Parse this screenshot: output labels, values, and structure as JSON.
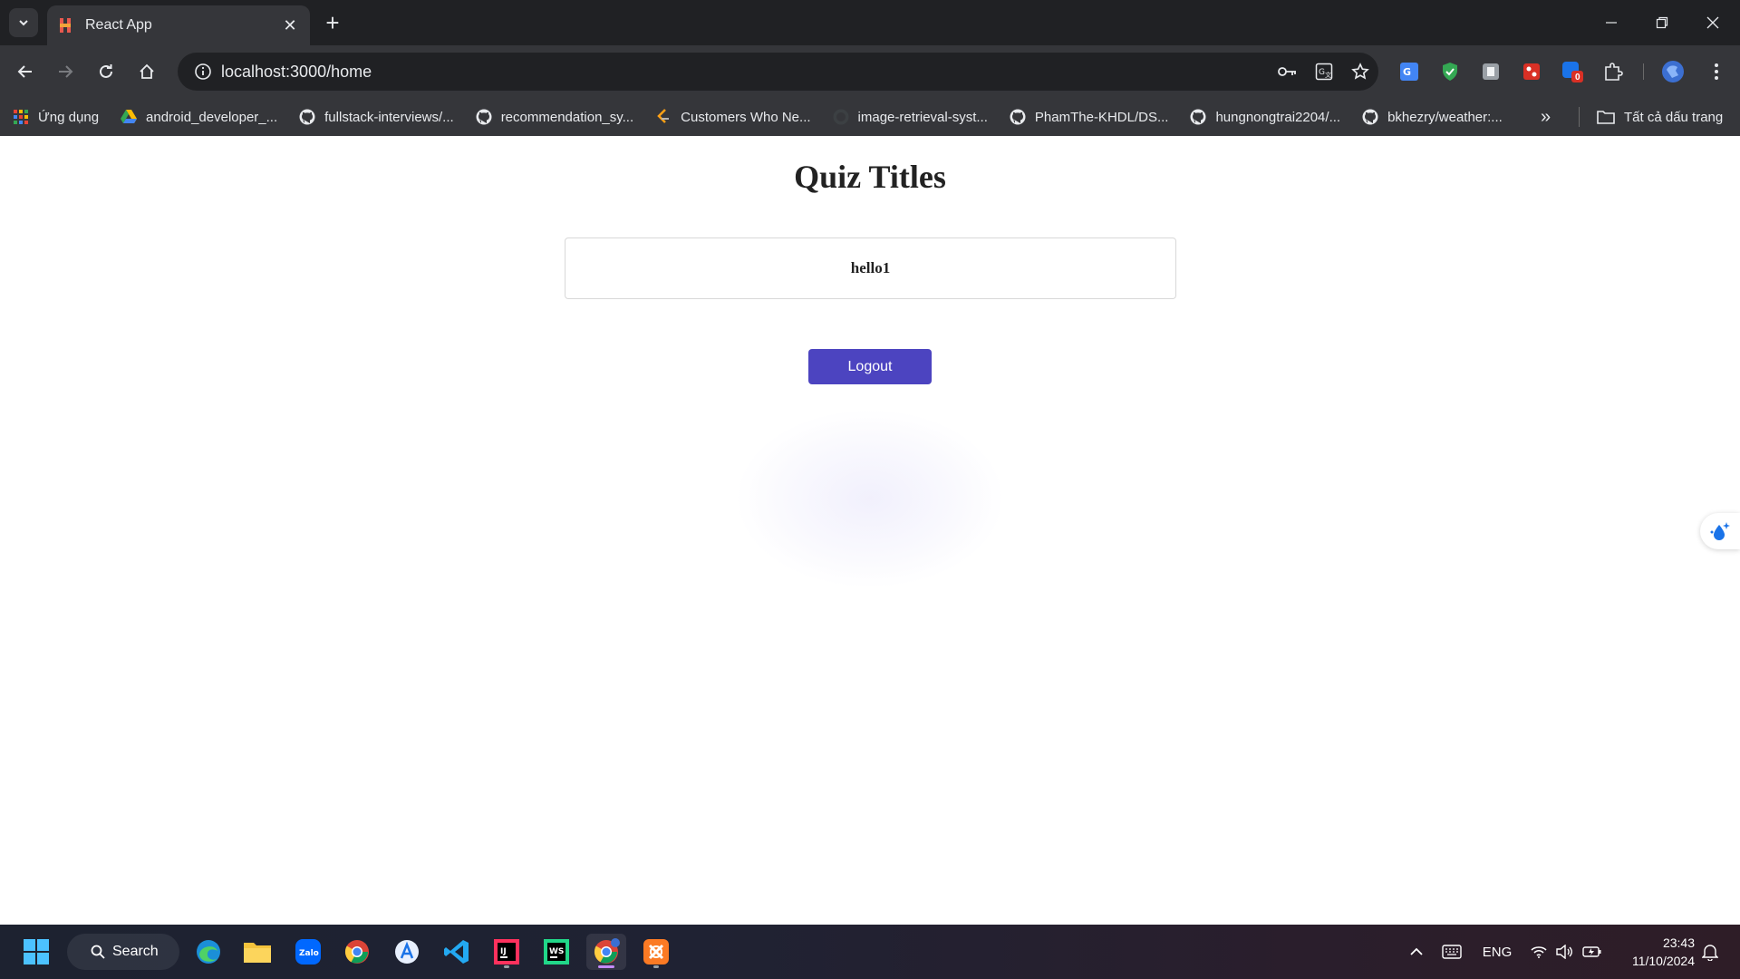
{
  "browser": {
    "tab_title": "React App",
    "url": "localhost:3000/home",
    "bookmarks": [
      {
        "label": "Ứng dụng",
        "icon": "apps-grid-icon"
      },
      {
        "label": "android_developer_...",
        "icon": "google-drive-icon"
      },
      {
        "label": "fullstack-interviews/...",
        "icon": "github-icon"
      },
      {
        "label": "recommendation_sy...",
        "icon": "github-icon"
      },
      {
        "label": "Customers Who Ne...",
        "icon": "leetcode-icon"
      },
      {
        "label": "image-retrieval-syst...",
        "icon": "github-icon"
      },
      {
        "label": "PhamThe-KHDL/DS...",
        "icon": "github-icon"
      },
      {
        "label": "hungnongtrai2204/...",
        "icon": "github-icon"
      },
      {
        "label": "bkhezry/weather:...",
        "icon": "github-icon"
      }
    ],
    "all_bookmarks_label": "Tất cả dấu trang",
    "extension_badge": "0"
  },
  "page": {
    "title": "Quiz Titles",
    "quizzes": [
      "hello1"
    ],
    "logout_label": "Logout"
  },
  "taskbar": {
    "search_label": "Search",
    "language": "ENG",
    "time": "23:43",
    "date": "11/10/2024"
  },
  "colors": {
    "accent": "#4c44c0",
    "chrome_dark": "#202124",
    "chrome_toolbar": "#35363a"
  }
}
